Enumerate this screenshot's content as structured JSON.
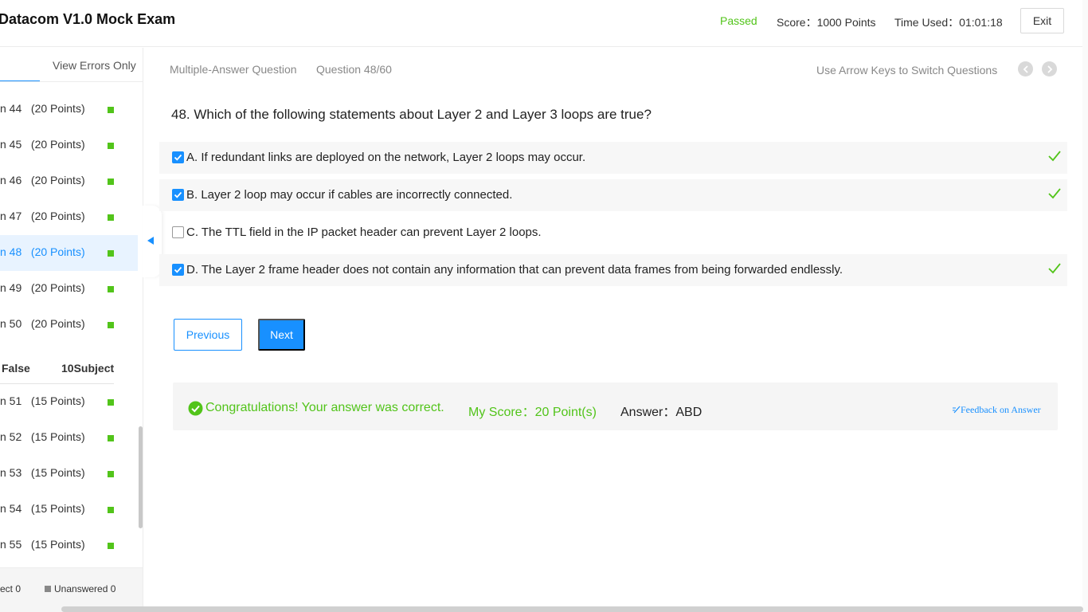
{
  "header": {
    "title": "Datacom V1.0 Mock Exam",
    "status": "Passed",
    "score": "Score：1000 Points",
    "time_used": "Time Used：01:01:18",
    "exit_label": "Exit"
  },
  "sidebar": {
    "tab_view_errors": "View Errors Only",
    "items_a": [
      {
        "label": "n 44   (20 Points)"
      },
      {
        "label": "n 45   (20 Points)"
      },
      {
        "label": "n 46   (20 Points)"
      },
      {
        "label": "n 47   (20 Points)"
      },
      {
        "label": "n 48   (20 Points)"
      },
      {
        "label": "n 49   (20 Points)"
      },
      {
        "label": "n 50   (20 Points)"
      }
    ],
    "section": {
      "left": "False",
      "right": "10Subject"
    },
    "items_b": [
      {
        "label": "n 51   (15 Points)"
      },
      {
        "label": "n 52   (15 Points)"
      },
      {
        "label": "n 53   (15 Points)"
      },
      {
        "label": "n 54   (15 Points)"
      },
      {
        "label": "n 55   (15 Points)"
      }
    ],
    "legend_correct": "ect 0",
    "legend_unanswered": "Unanswered 0"
  },
  "main": {
    "question_type": "Multiple-Answer Question",
    "question_number": "Question 48/60",
    "arrow_hint": "Use Arrow Keys to Switch Questions",
    "question_text": "48. Which of the following statements about Layer 2 and Layer 3 loops are true?",
    "options": [
      {
        "text": "A. If redundant links are deployed on the network, Layer 2 loops may occur.",
        "checked": true,
        "correct": true
      },
      {
        "text": "B. Layer 2 loop may occur if cables are incorrectly connected.",
        "checked": true,
        "correct": true
      },
      {
        "text": "C. The TTL field in the IP packet header can prevent Layer 2 loops.",
        "checked": false,
        "correct": false
      },
      {
        "text": "D. The Layer 2 frame header does not contain any information that can prevent data frames from being forwarded endlessly.",
        "checked": true,
        "correct": true
      }
    ],
    "previous_label": "Previous",
    "next_label": "Next"
  },
  "result": {
    "congrats": "Congratulations! Your answer was correct.",
    "my_score": "My Score：20 Point(s)",
    "answer": "Answer：ABD",
    "feedback": "Feedback on Answer"
  },
  "colors": {
    "accent": "#1890ff",
    "success": "#52c41a",
    "active_row": "#e8f3ff"
  }
}
